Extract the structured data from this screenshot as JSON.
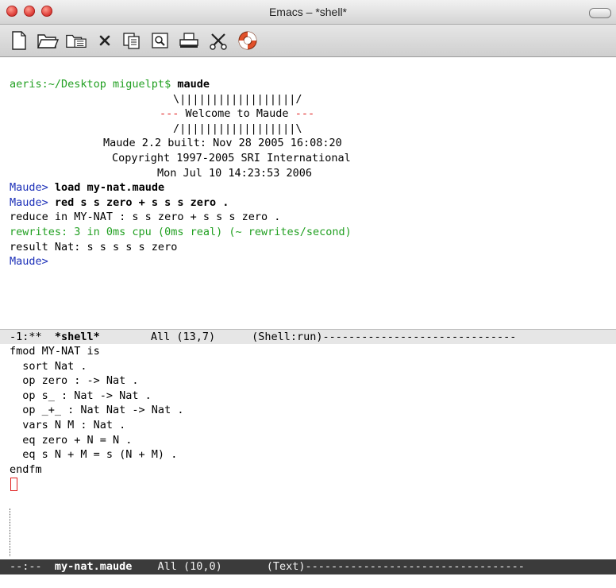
{
  "window": {
    "title": "Emacs – *shell*"
  },
  "toolbar": {
    "buttons": [
      {
        "name": "new-file",
        "icon": "new-file-icon"
      },
      {
        "name": "open-folder",
        "icon": "open-folder-icon"
      },
      {
        "name": "open-directory",
        "icon": "open-directory-icon"
      },
      {
        "name": "close",
        "icon": "close-icon"
      },
      {
        "name": "copy",
        "icon": "copy-icon"
      },
      {
        "name": "search",
        "icon": "search-icon"
      },
      {
        "name": "print",
        "icon": "print-icon"
      },
      {
        "name": "preferences",
        "icon": "tools-icon"
      },
      {
        "name": "help",
        "icon": "lifebuoy-icon"
      }
    ]
  },
  "shell": {
    "prompt_line": {
      "host": "aeris:~/Desktop miguelpt$ ",
      "cmd": "maude"
    },
    "banner_top": "\\||||||||||||||||||/",
    "banner_welcome_dashes_l": "--- ",
    "banner_welcome_text": "Welcome to Maude",
    "banner_welcome_dashes_r": " ---",
    "banner_bottom": "/||||||||||||||||||\\",
    "built": "Maude 2.2 built: Nov 28 2005 16:08:20",
    "copyright": "Copyright 1997-2005 SRI International",
    "date": "Mon Jul 10 14:23:53 2006",
    "prompt": "Maude>",
    "cmd_load": "load my-nat.maude",
    "cmd_red": "red s s zero + s s s zero .",
    "reduce_line": "reduce in MY-NAT : s s zero + s s s zero .",
    "rewrites_line": "rewrites: 3 in 0ms cpu (0ms real) (~ rewrites/second)",
    "result_line": "result Nat: s s s s s zero",
    "final_prompt": "Maude>"
  },
  "modeline_shell": {
    "status": "-1:**  ",
    "buffer": "*shell*",
    "position": "All (13,7)",
    "mode": "(Shell:run)------------------------------"
  },
  "source": {
    "lines": [
      "fmod MY-NAT is",
      "  sort Nat .",
      "  op zero : -> Nat .",
      "  op s_ : Nat -> Nat .",
      "  op _+_ : Nat Nat -> Nat .",
      "  vars N M : Nat .",
      "  eq zero + N = N .",
      "  eq s N + M = s (N + M) .",
      "endfm"
    ]
  },
  "modeline_file": {
    "status": "--:--  ",
    "buffer": "my-nat.maude",
    "position": "All (10,0)",
    "mode": "(Text)----------------------------------"
  }
}
